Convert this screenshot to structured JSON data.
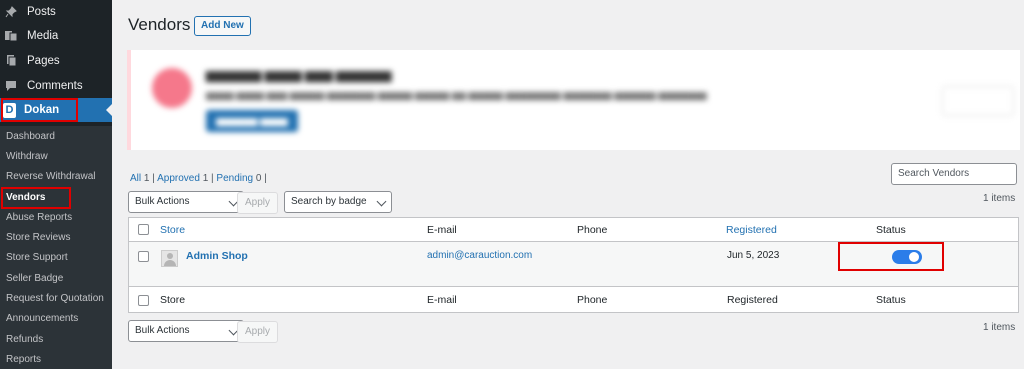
{
  "sidebar": {
    "menu": [
      {
        "label": "Posts",
        "icon": "pushpin-icon"
      },
      {
        "label": "Media",
        "icon": "media-icon"
      },
      {
        "label": "Pages",
        "icon": "pages-icon"
      },
      {
        "label": "Comments",
        "icon": "comment-icon"
      }
    ],
    "dokan": {
      "label": "Dokan",
      "logo_letter": "D"
    },
    "submenu": [
      "Dashboard",
      "Withdraw",
      "Reverse Withdrawal",
      "Vendors",
      "Abuse Reports",
      "Store Reviews",
      "Store Support",
      "Seller Badge",
      "Request for Quotation",
      "Announcements",
      "Refunds",
      "Reports"
    ],
    "current_submenu": "Vendors"
  },
  "header": {
    "title": "Vendors",
    "add_new": "Add New"
  },
  "filters": {
    "all_label": "All",
    "all_count": "1",
    "approved_label": "Approved",
    "approved_count": "1",
    "pending_label": "Pending",
    "pending_count": "0",
    "sep": "|"
  },
  "search": {
    "placeholder": "Search Vendors"
  },
  "toolbar": {
    "bulk_actions": "Bulk Actions",
    "apply": "Apply",
    "badge_filter": "Search by badge",
    "items_count": "1 items"
  },
  "table": {
    "columns": {
      "store": "Store",
      "email": "E-mail",
      "phone": "Phone",
      "registered": "Registered",
      "status": "Status"
    },
    "rows": [
      {
        "store": "Admin Shop",
        "email": "admin@carauction.com",
        "phone": "",
        "registered": "Jun 5, 2023",
        "status_enabled": true
      }
    ]
  },
  "colors": {
    "accent": "#2271b1",
    "sidebar": "#1d2327",
    "highlight": "#e00000",
    "toggle_on": "#2b7de9"
  }
}
